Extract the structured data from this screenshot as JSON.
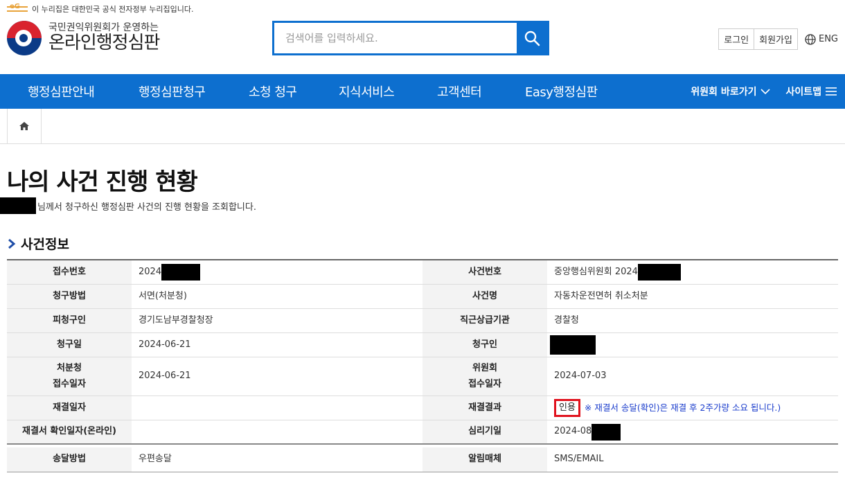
{
  "notice": {
    "text": "이 누리집은 대한민국 공식 전자정부 누리집입니다.",
    "badge": "eG"
  },
  "header": {
    "logo_sub": "국민권익위원회가 운영하는",
    "logo_main": "온라인행정심판",
    "search_placeholder": "검색어를 입력하세요.",
    "login": "로그인",
    "join": "회원가입",
    "lang": "ENG"
  },
  "nav": {
    "items": [
      "행정심판안내",
      "행정심판청구",
      "소청 청구",
      "지식서비스",
      "고객센터",
      "Easy행정심판"
    ],
    "committee": "위원회 바로가기",
    "sitemap": "사이트맵"
  },
  "page": {
    "title": "나의 사건 진행 현황",
    "desc": "님께서 청구하신 행정심판 사건의 진행 현황을 조회합니다.",
    "section": "사건정보"
  },
  "case": {
    "labels": {
      "receipt_no": "접수번호",
      "case_no": "사건번호",
      "method": "청구방법",
      "case_name": "사건명",
      "respondent": "피청구인",
      "superior": "직근상급기관",
      "claim_date": "청구일",
      "claimant": "청구인",
      "agency_date_1": "처분청",
      "agency_date_2": "접수일자",
      "committee_date_1": "위원회",
      "committee_date_2": "접수일자",
      "ruling_date": "재결일자",
      "ruling_result": "재결결과",
      "confirm_date": "재결서 확인일자(온라인)",
      "hearing_date": "심리기일",
      "delivery": "송달방법",
      "notify": "알림매체"
    },
    "values": {
      "receipt_no": "2024",
      "case_no": "중앙행심위원회 2024",
      "method": "서면(처분청)",
      "case_name": "자동차운전면허 취소처분",
      "respondent": "경기도남부경찰청장",
      "superior": "경찰청",
      "claim_date": "2024-06-21",
      "agency_date": "2024-06-21",
      "committee_date": "2024-07-03",
      "ruling_result": "인용",
      "ruling_notice": "※ 재결서 송달(확인)은 재결 후 2주가량 소요 됩니다.)",
      "hearing_date": "2024-08",
      "delivery": "우편송달",
      "notify": "SMS/EMAIL"
    }
  },
  "colors": {
    "primary": "#0d6fcf",
    "highlight": "#e0111c",
    "notice": "#1a3ccc"
  }
}
